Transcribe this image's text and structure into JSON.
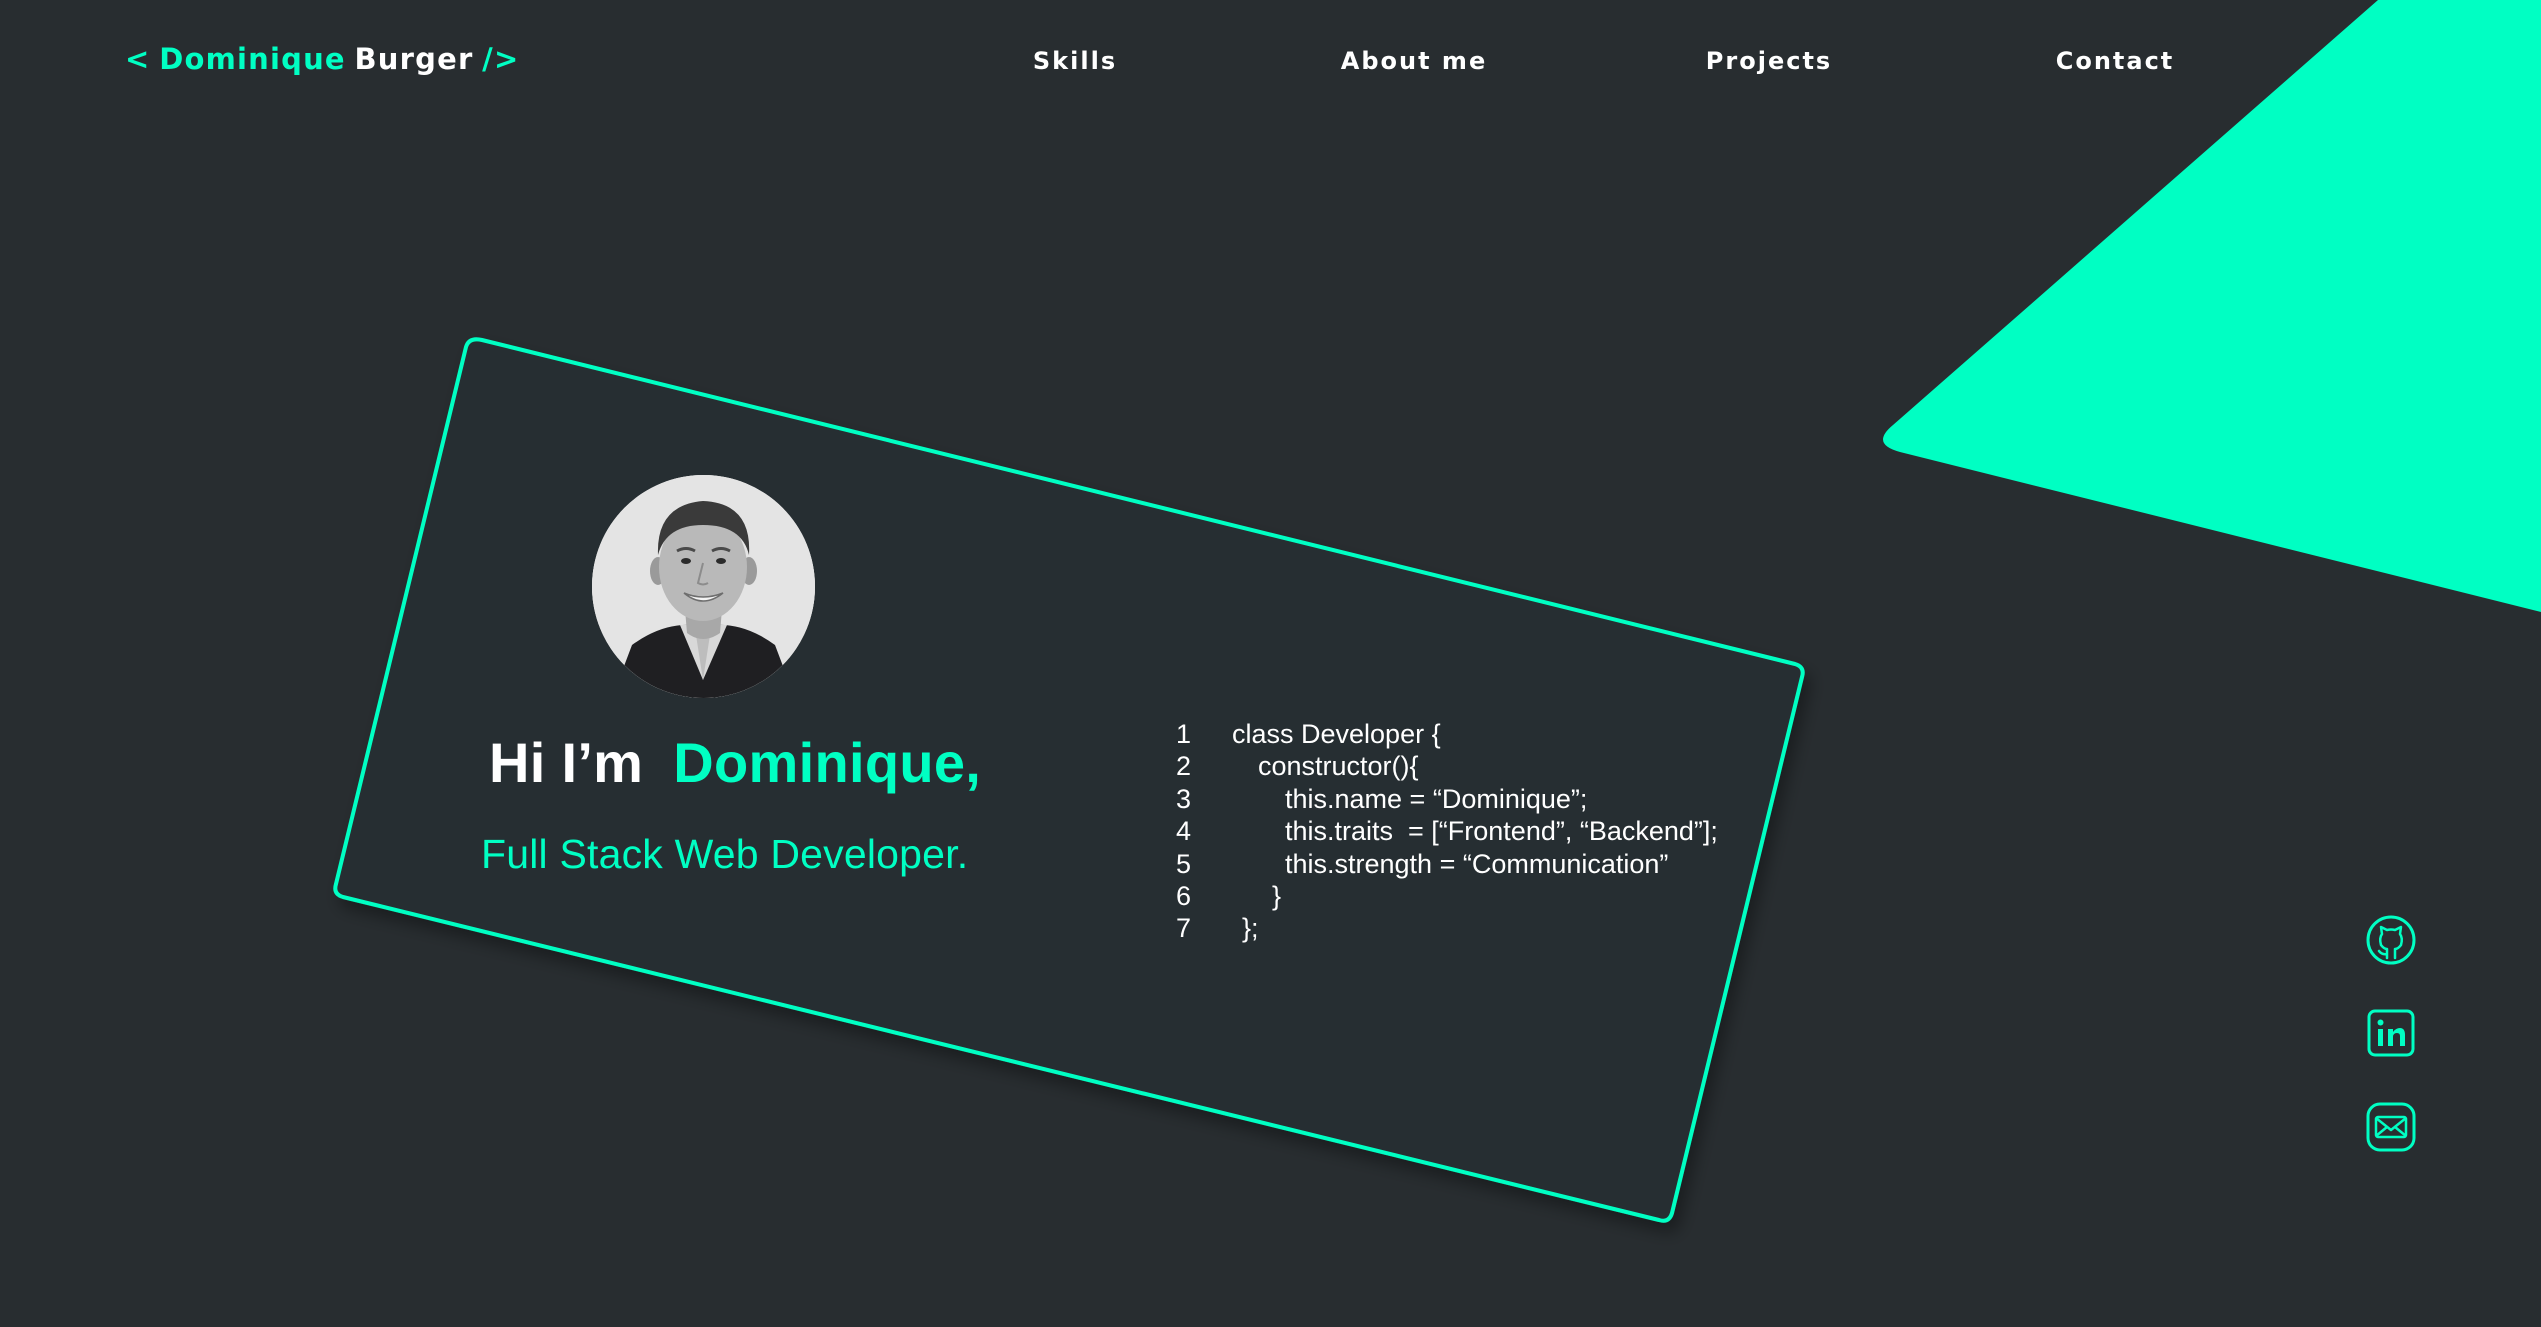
{
  "header": {
    "logo": {
      "open": "<",
      "first_name": "Dominique",
      "last_name": "Burger",
      "close": "/>"
    },
    "nav": [
      {
        "label": "Skills"
      },
      {
        "label": "About me"
      },
      {
        "label": "Projects"
      },
      {
        "label": "Contact"
      }
    ]
  },
  "hero": {
    "greeting": "Hi I’m",
    "name": "Dominique,",
    "role": "Full Stack Web Developer.",
    "avatar_icon": "profile-photo",
    "code": [
      {
        "n": "1",
        "text": "class Developer {"
      },
      {
        "n": "2",
        "text": "constructor(){"
      },
      {
        "n": "3",
        "text": "this.name = “Dominique”;"
      },
      {
        "n": "4",
        "text": "this.traits  = [“Frontend”, “Backend”];"
      },
      {
        "n": "5",
        "text": "this.strength = “Communication”"
      },
      {
        "n": "6",
        "text": "}"
      },
      {
        "n": "7",
        "text": "};"
      }
    ]
  },
  "social": [
    {
      "icon": "github-icon"
    },
    {
      "icon": "linkedin-icon"
    },
    {
      "icon": "mail-icon"
    }
  ],
  "colors": {
    "background": "#282d30",
    "accent": "#00ffc3",
    "text": "#ffffff"
  }
}
